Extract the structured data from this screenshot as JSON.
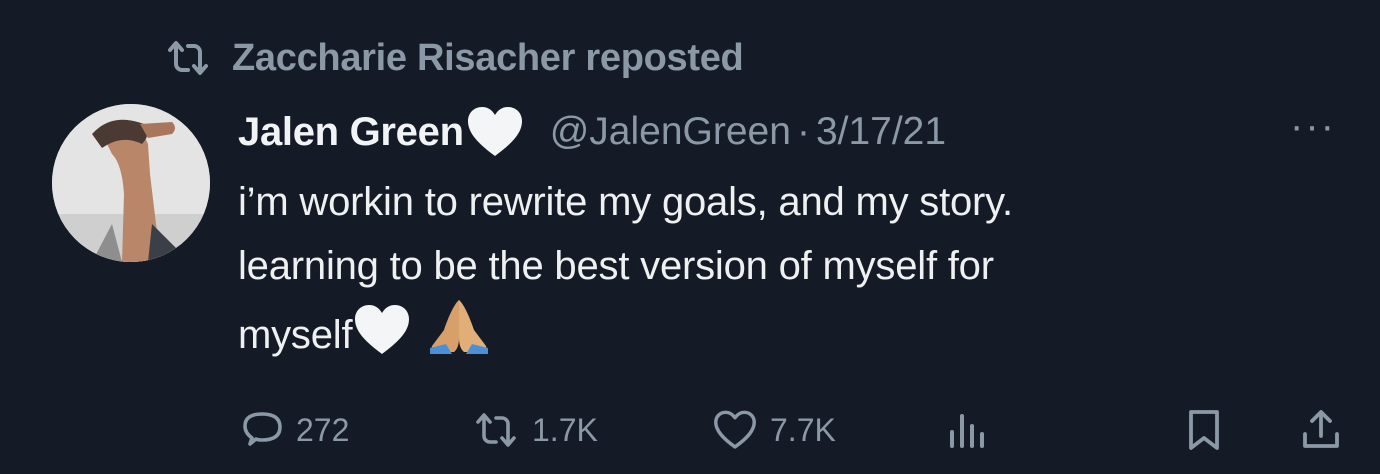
{
  "repost": {
    "icon": "repost-icon",
    "text": "Zaccharie Risacher reposted"
  },
  "author": {
    "display_name": "Jalen Green",
    "name_emoji": "white-heart-icon",
    "handle": "@JalenGreen",
    "separator": "·",
    "date": "3/17/21"
  },
  "more_label": "···",
  "body": {
    "line1": "i’m workin to rewrite my goals, and my story.",
    "line2": "learning to be the best version of myself for",
    "line3": "myself"
  },
  "actions": {
    "replies": {
      "icon": "reply-icon",
      "count": "272"
    },
    "reposts": {
      "icon": "repost-icon",
      "count": "1.7K"
    },
    "likes": {
      "icon": "heart-icon",
      "count": "7.7K"
    },
    "views": {
      "icon": "views-icon"
    },
    "bookmark": {
      "icon": "bookmark-icon"
    },
    "share": {
      "icon": "share-icon"
    }
  },
  "colors": {
    "background": "#151b26",
    "primary_text": "#e7e9ea",
    "secondary_text": "#8b98a5"
  }
}
